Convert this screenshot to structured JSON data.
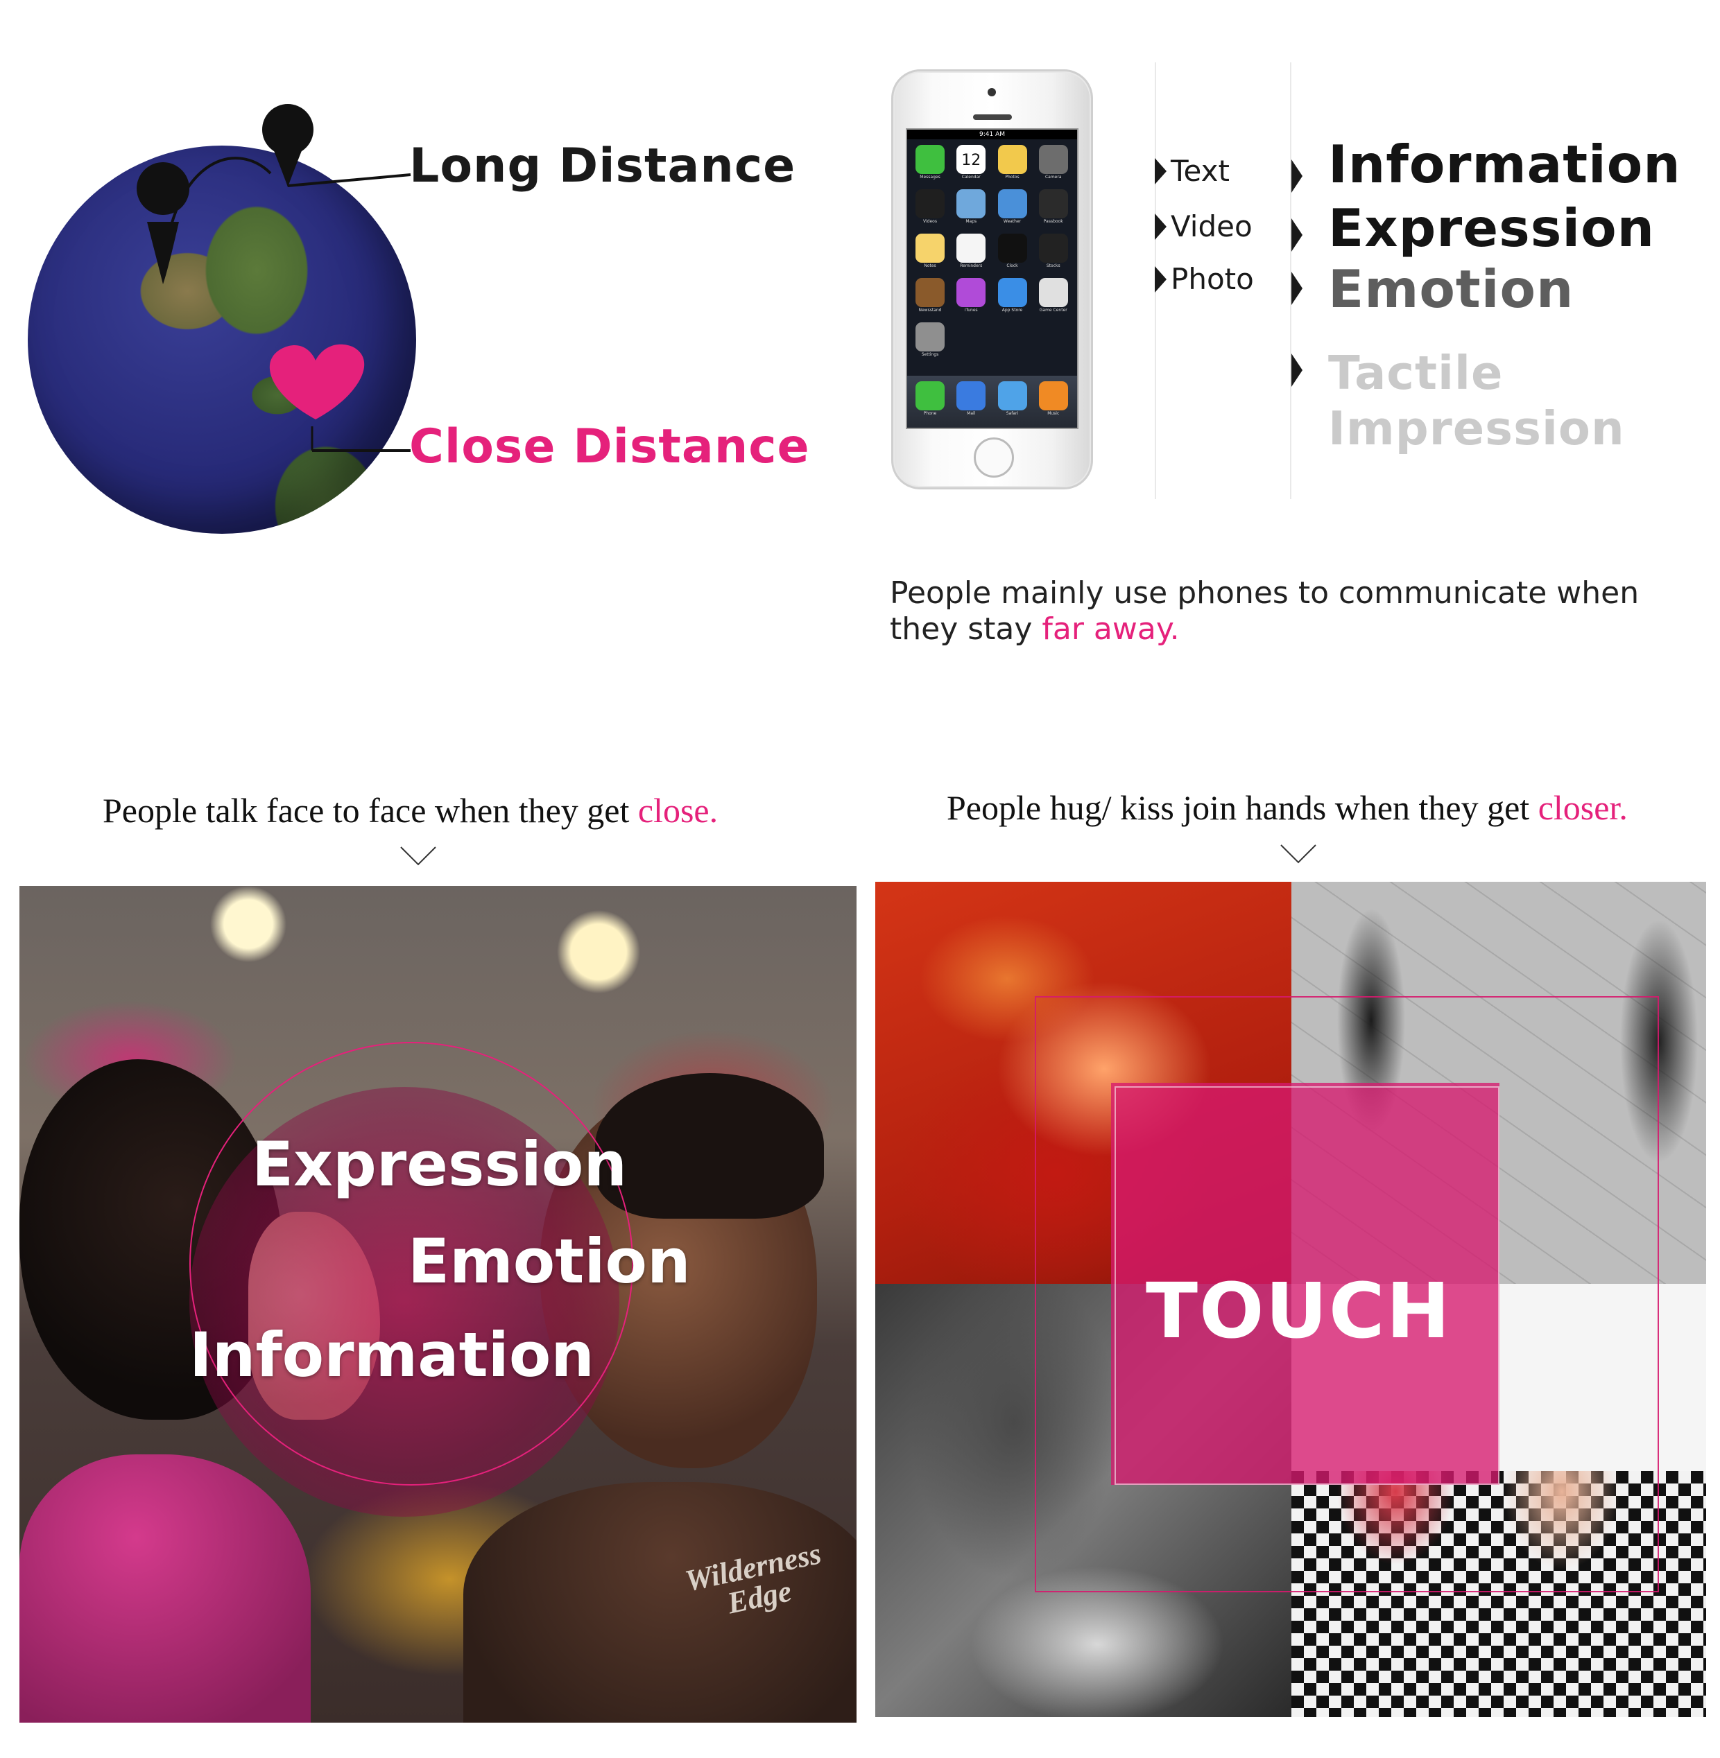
{
  "distance": {
    "long_label": "Long Distance",
    "close_label": "Close Distance"
  },
  "phone": {
    "status_time": "9:41 AM",
    "calendar_day": "12",
    "apps": [
      {
        "name": "Messages",
        "color": "#3fbf3f"
      },
      {
        "name": "Calendar",
        "color": "#ffffff"
      },
      {
        "name": "Photos",
        "color": "#f2c94c"
      },
      {
        "name": "Camera",
        "color": "#6d6d6d"
      },
      {
        "name": "Videos",
        "color": "#1f1f1f"
      },
      {
        "name": "Maps",
        "color": "#6fa8dc"
      },
      {
        "name": "Weather",
        "color": "#4a90d9"
      },
      {
        "name": "Passbook",
        "color": "#2b2b2b"
      },
      {
        "name": "Notes",
        "color": "#f6d36b"
      },
      {
        "name": "Reminders",
        "color": "#f5f5f5"
      },
      {
        "name": "Clock",
        "color": "#111111"
      },
      {
        "name": "Stocks",
        "color": "#222222"
      },
      {
        "name": "Newsstand",
        "color": "#8a5a2b"
      },
      {
        "name": "iTunes",
        "color": "#b04bd8"
      },
      {
        "name": "App Store",
        "color": "#3a8ee6"
      },
      {
        "name": "Game Center",
        "color": "#e0e0e0"
      },
      {
        "name": "Settings",
        "color": "#8f8f8f"
      }
    ],
    "dock": [
      {
        "name": "Phone",
        "color": "#3fbf3f"
      },
      {
        "name": "Mail",
        "color": "#3a7be0"
      },
      {
        "name": "Safari",
        "color": "#4fa3e8"
      },
      {
        "name": "Music",
        "color": "#f08a24"
      }
    ]
  },
  "media_types": [
    "Text",
    "Video",
    "Photo"
  ],
  "terms": {
    "information": "Information",
    "expression": "Expression",
    "emotion": "Emotion",
    "tactile": "Tactile",
    "impression": "Impression"
  },
  "phone_caption": {
    "before": "People mainly use phones to communicate when they stay ",
    "highlight": "far away."
  },
  "left_caption": {
    "before": "People talk face to face when they get ",
    "highlight": "close."
  },
  "right_caption": {
    "before": "People hug/ kiss join hands when they get ",
    "highlight": "closer."
  },
  "left_photo": {
    "words": [
      "Expression",
      "Emotion",
      "Information"
    ],
    "shirt_text": "Wilderness Edge"
  },
  "right_photo": {
    "word": "TOUCH"
  },
  "colors": {
    "accent": "#e5217b",
    "dark_text": "#1a1a1a",
    "mid_gray": "#5e5e5e",
    "light_gray": "#cacaca"
  }
}
